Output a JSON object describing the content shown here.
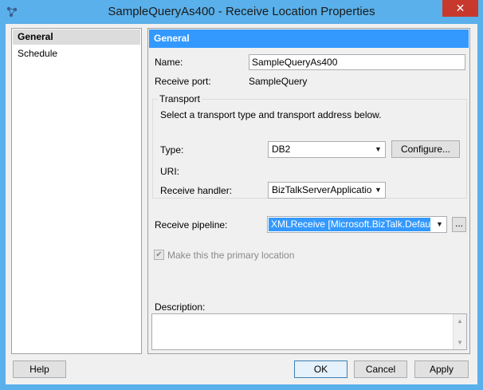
{
  "window": {
    "title": "SampleQueryAs400 - Receive Location Properties",
    "close_glyph": "✕"
  },
  "sidebar": {
    "items": [
      {
        "label": "General",
        "selected": true
      },
      {
        "label": "Schedule",
        "selected": false
      }
    ]
  },
  "general": {
    "header": "General",
    "name_label": "Name:",
    "name_value": "SampleQueryAs400",
    "receive_port_label": "Receive port:",
    "receive_port_value": "SampleQuery",
    "transport": {
      "title": "Transport",
      "instruction": "Select a transport type and transport address below.",
      "type_label": "Type:",
      "type_value": "DB2",
      "configure_label": "Configure...",
      "uri_label": "URI:",
      "receive_handler_label": "Receive handler:",
      "receive_handler_value": "BizTalkServerApplication"
    },
    "pipeline_label": "Receive pipeline:",
    "pipeline_value": "XMLReceive      [Microsoft.BizTalk.DefaultPip",
    "pipeline_browse_label": "...",
    "primary_location_label": "Make this the primary location",
    "primary_location_checked": true,
    "description_label": "Description:",
    "description_value": ""
  },
  "footer": {
    "help_label": "Help",
    "ok_label": "OK",
    "cancel_label": "Cancel",
    "apply_label": "Apply"
  },
  "colors": {
    "titlebar": "#5ab0ea",
    "header_accent": "#3399ff",
    "close_button": "#c7392d"
  }
}
